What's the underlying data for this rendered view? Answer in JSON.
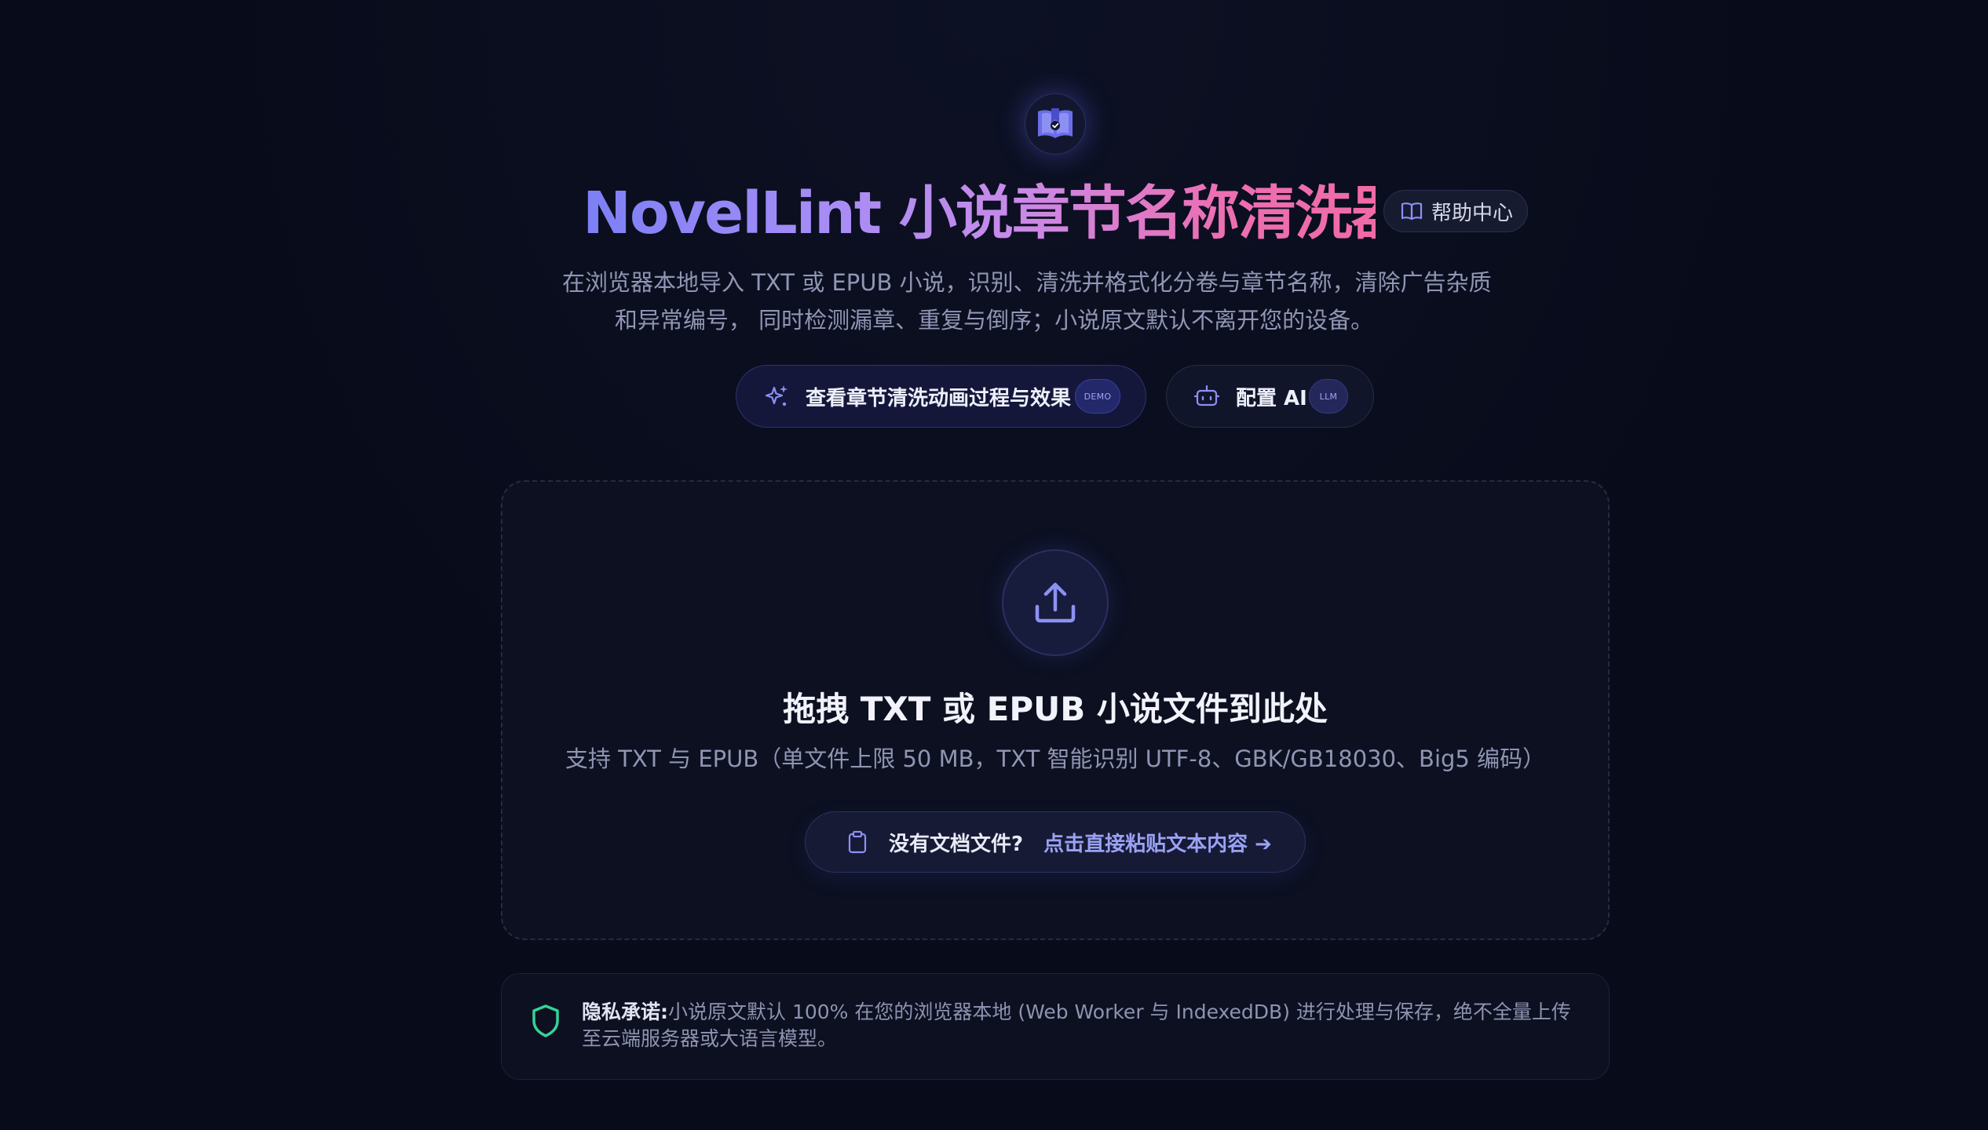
{
  "header": {
    "logo_icon": "book-check-icon",
    "title": "NovelLint 小说章节名称清洗器",
    "help_label": "帮助中心",
    "subtitle_line1": "在浏览器本地导入 TXT 或 EPUB 小说，识别、清洗并格式化分卷与章节名称，清除广告杂质",
    "subtitle_line2": "和异常编号， 同时检测漏章、重复与倒序；小说原文默认不离开您的设备。"
  },
  "actions": {
    "demo_label": "查看章节清洗动画过程与效果",
    "demo_tag": "DEMO",
    "ai_label": "配置 AI",
    "ai_tag": "LLM"
  },
  "dropzone": {
    "icon": "upload-icon",
    "title": "拖拽 TXT 或 EPUB 小说文件到此处",
    "description": "支持 TXT 与 EPUB（单文件上限 50 MB，TXT 智能识别 UTF-8、GBK/GB18030、Big5 编码）",
    "paste_prompt": "没有文档文件?",
    "paste_link": "点击直接粘贴文本内容 ➔"
  },
  "privacy": {
    "label": "隐私承诺:",
    "text": "小说原文默认 100% 在您的浏览器本地 (Web Worker 与 IndexedDB) 进行处理与保存，绝不全量上传至云端服务器或大语言模型。"
  },
  "colors": {
    "background": "#080b19",
    "accent_indigo": "#7c7ff6",
    "accent_pink": "#f06aa6",
    "privacy_green": "#34d399"
  }
}
